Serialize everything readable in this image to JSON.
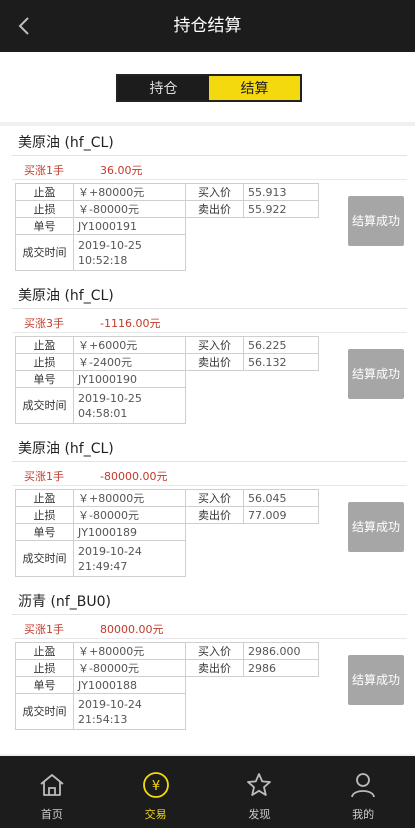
{
  "header": {
    "title": "持仓结算"
  },
  "tabs": {
    "holding": "持仓",
    "settlement": "结算"
  },
  "labels": {
    "take_profit": "止盈",
    "stop_loss": "止损",
    "order_no": "单号",
    "deal_time": "成交时间",
    "buy_price": "买入价",
    "sell_price": "卖出价",
    "settle_line1": "结算",
    "settle_line2": "成功"
  },
  "trades": [
    {
      "name": "美原油 (hf_CL)",
      "direction": "买涨1手",
      "pnl": "36.00元",
      "take_profit": "￥+80000元",
      "stop_loss": "￥-80000元",
      "buy_price": "55.913",
      "sell_price": "55.922",
      "order_no": "JY1000191",
      "date": "2019-10-25",
      "time": "10:52:18"
    },
    {
      "name": "美原油 (hf_CL)",
      "direction": "买涨3手",
      "pnl": "-1116.00元",
      "take_profit": "￥+6000元",
      "stop_loss": "￥-2400元",
      "buy_price": "56.225",
      "sell_price": "56.132",
      "order_no": "JY1000190",
      "date": "2019-10-25",
      "time": "04:58:01"
    },
    {
      "name": "美原油 (hf_CL)",
      "direction": "买涨1手",
      "pnl": "-80000.00元",
      "take_profit": "￥+80000元",
      "stop_loss": "￥-80000元",
      "buy_price": "56.045",
      "sell_price": "77.009",
      "order_no": "JY1000189",
      "date": "2019-10-24",
      "time": "21:49:47"
    },
    {
      "name": "沥青 (nf_BU0)",
      "direction": "买涨1手",
      "pnl": "80000.00元",
      "take_profit": "￥+80000元",
      "stop_loss": "￥-80000元",
      "buy_price": "2986.000",
      "sell_price": "2986",
      "order_no": "JY1000188",
      "date": "2019-10-24",
      "time": "21:54:13"
    }
  ],
  "bottom_nav": [
    {
      "label": "首页",
      "icon": "home-icon"
    },
    {
      "label": "交易",
      "icon": "yen-coin-icon"
    },
    {
      "label": "发现",
      "icon": "star-icon"
    },
    {
      "label": "我的",
      "icon": "user-icon"
    }
  ]
}
